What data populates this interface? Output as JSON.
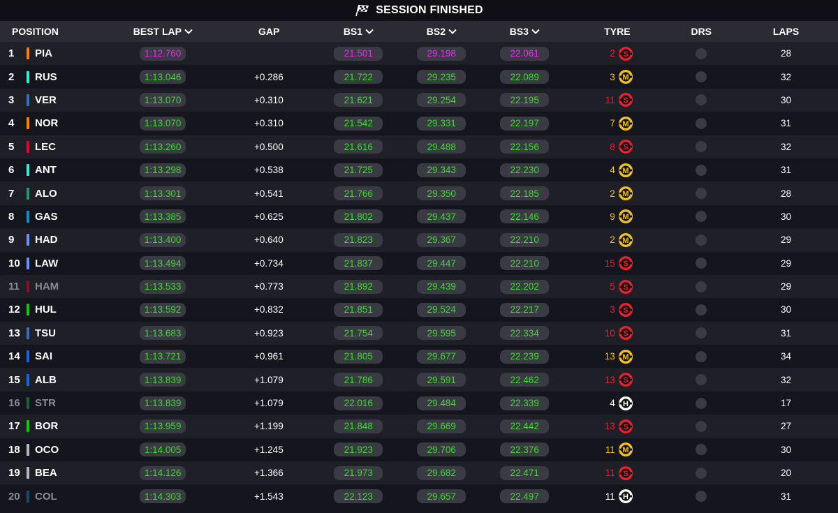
{
  "banner": {
    "title": "SESSION FINISHED",
    "icon": "chequered-flag-icon"
  },
  "columns": {
    "position": "POSITION",
    "best_lap": "BEST LAP",
    "gap": "GAP",
    "bs1": "BS1",
    "bs2": "BS2",
    "bs3": "BS3",
    "tyre": "TYRE",
    "drs": "DRS",
    "laps": "LAPS"
  },
  "colors": {
    "purple": "#e233e2",
    "green": "#3edb2c",
    "soft": "#e8212d",
    "medium": "#f5c21b",
    "hard": "#ffffff"
  },
  "rows": [
    {
      "pos": "1",
      "code": "PIA",
      "team_color": "#ff8000",
      "faded": false,
      "best_lap": "1:12.760",
      "best_color": "purple",
      "gap": "",
      "bs1": "21.501",
      "bs1_color": "purple",
      "bs2": "29.198",
      "bs2_color": "purple",
      "bs3": "22.061",
      "bs3_color": "purple",
      "tyre_age": "2",
      "tyre": "S",
      "laps": "28"
    },
    {
      "pos": "2",
      "code": "RUS",
      "team_color": "#27f4d2",
      "faded": false,
      "best_lap": "1:13.046",
      "best_color": "green",
      "gap": "+0.286",
      "bs1": "21.722",
      "bs1_color": "green",
      "bs2": "29.235",
      "bs2_color": "green",
      "bs3": "22.089",
      "bs3_color": "green",
      "tyre_age": "3",
      "tyre": "M",
      "laps": "32"
    },
    {
      "pos": "3",
      "code": "VER",
      "team_color": "#3671c6",
      "faded": false,
      "best_lap": "1:13.070",
      "best_color": "green",
      "gap": "+0.310",
      "bs1": "21.621",
      "bs1_color": "green",
      "bs2": "29.254",
      "bs2_color": "green",
      "bs3": "22.195",
      "bs3_color": "green",
      "tyre_age": "11",
      "tyre": "S",
      "laps": "30"
    },
    {
      "pos": "4",
      "code": "NOR",
      "team_color": "#ff8000",
      "faded": false,
      "best_lap": "1:13.070",
      "best_color": "green",
      "gap": "+0.310",
      "bs1": "21.542",
      "bs1_color": "green",
      "bs2": "29.331",
      "bs2_color": "green",
      "bs3": "22.197",
      "bs3_color": "green",
      "tyre_age": "7",
      "tyre": "M",
      "laps": "31"
    },
    {
      "pos": "5",
      "code": "LEC",
      "team_color": "#e8002d",
      "faded": false,
      "best_lap": "1:13.260",
      "best_color": "green",
      "gap": "+0.500",
      "bs1": "21.616",
      "bs1_color": "green",
      "bs2": "29.488",
      "bs2_color": "green",
      "bs3": "22.156",
      "bs3_color": "green",
      "tyre_age": "8",
      "tyre": "S",
      "laps": "32"
    },
    {
      "pos": "6",
      "code": "ANT",
      "team_color": "#27f4d2",
      "faded": false,
      "best_lap": "1:13.298",
      "best_color": "green",
      "gap": "+0.538",
      "bs1": "21.725",
      "bs1_color": "green",
      "bs2": "29.343",
      "bs2_color": "green",
      "bs3": "22.230",
      "bs3_color": "green",
      "tyre_age": "4",
      "tyre": "M",
      "laps": "31"
    },
    {
      "pos": "7",
      "code": "ALO",
      "team_color": "#229971",
      "faded": false,
      "best_lap": "1:13.301",
      "best_color": "green",
      "gap": "+0.541",
      "bs1": "21.766",
      "bs1_color": "green",
      "bs2": "29.350",
      "bs2_color": "green",
      "bs3": "22.185",
      "bs3_color": "green",
      "tyre_age": "2",
      "tyre": "M",
      "laps": "28"
    },
    {
      "pos": "8",
      "code": "GAS",
      "team_color": "#0093cc",
      "faded": false,
      "best_lap": "1:13.385",
      "best_color": "green",
      "gap": "+0.625",
      "bs1": "21.802",
      "bs1_color": "green",
      "bs2": "29.437",
      "bs2_color": "green",
      "bs3": "22.146",
      "bs3_color": "green",
      "tyre_age": "9",
      "tyre": "M",
      "laps": "30"
    },
    {
      "pos": "9",
      "code": "HAD",
      "team_color": "#6692ff",
      "faded": false,
      "best_lap": "1:13.400",
      "best_color": "green",
      "gap": "+0.640",
      "bs1": "21.823",
      "bs1_color": "green",
      "bs2": "29.367",
      "bs2_color": "green",
      "bs3": "22.210",
      "bs3_color": "green",
      "tyre_age": "2",
      "tyre": "M",
      "laps": "29"
    },
    {
      "pos": "10",
      "code": "LAW",
      "team_color": "#6692ff",
      "faded": false,
      "best_lap": "1:13.494",
      "best_color": "green",
      "gap": "+0.734",
      "bs1": "21.837",
      "bs1_color": "green",
      "bs2": "29.447",
      "bs2_color": "green",
      "bs3": "22.210",
      "bs3_color": "green",
      "tyre_age": "15",
      "tyre": "S",
      "laps": "29"
    },
    {
      "pos": "11",
      "code": "HAM",
      "team_color": "#8a1020",
      "faded": true,
      "best_lap": "1:13.533",
      "best_color": "green",
      "gap": "+0.773",
      "bs1": "21.892",
      "bs1_color": "green",
      "bs2": "29.439",
      "bs2_color": "green",
      "bs3": "22.202",
      "bs3_color": "green",
      "tyre_age": "5",
      "tyre": "S",
      "laps": "29"
    },
    {
      "pos": "12",
      "code": "HUL",
      "team_color": "#00d000",
      "faded": false,
      "best_lap": "1:13.592",
      "best_color": "green",
      "gap": "+0.832",
      "bs1": "21.851",
      "bs1_color": "green",
      "bs2": "29.524",
      "bs2_color": "green",
      "bs3": "22.217",
      "bs3_color": "green",
      "tyre_age": "3",
      "tyre": "S",
      "laps": "30"
    },
    {
      "pos": "13",
      "code": "TSU",
      "team_color": "#3671c6",
      "faded": false,
      "best_lap": "1:13.683",
      "best_color": "green",
      "gap": "+0.923",
      "bs1": "21.754",
      "bs1_color": "green",
      "bs2": "29.595",
      "bs2_color": "green",
      "bs3": "22.334",
      "bs3_color": "green",
      "tyre_age": "10",
      "tyre": "S",
      "laps": "31"
    },
    {
      "pos": "14",
      "code": "SAI",
      "team_color": "#1868db",
      "faded": false,
      "best_lap": "1:13.721",
      "best_color": "green",
      "gap": "+0.961",
      "bs1": "21.805",
      "bs1_color": "green",
      "bs2": "29.677",
      "bs2_color": "green",
      "bs3": "22.239",
      "bs3_color": "green",
      "tyre_age": "13",
      "tyre": "M",
      "laps": "34"
    },
    {
      "pos": "15",
      "code": "ALB",
      "team_color": "#1868db",
      "faded": false,
      "best_lap": "1:13.839",
      "best_color": "green",
      "gap": "+1.079",
      "bs1": "21.786",
      "bs1_color": "green",
      "bs2": "29.591",
      "bs2_color": "green",
      "bs3": "22.462",
      "bs3_color": "green",
      "tyre_age": "13",
      "tyre": "S",
      "laps": "32"
    },
    {
      "pos": "16",
      "code": "STR",
      "team_color": "#1f5f46",
      "faded": true,
      "best_lap": "1:13.839",
      "best_color": "green",
      "gap": "+1.079",
      "bs1": "22.016",
      "bs1_color": "green",
      "bs2": "29.484",
      "bs2_color": "green",
      "bs3": "22.339",
      "bs3_color": "green",
      "tyre_age": "4",
      "tyre": "H",
      "laps": "17"
    },
    {
      "pos": "17",
      "code": "BOR",
      "team_color": "#00d000",
      "faded": false,
      "best_lap": "1:13.959",
      "best_color": "green",
      "gap": "+1.199",
      "bs1": "21.848",
      "bs1_color": "green",
      "bs2": "29.669",
      "bs2_color": "green",
      "bs3": "22.442",
      "bs3_color": "green",
      "tyre_age": "13",
      "tyre": "S",
      "laps": "27"
    },
    {
      "pos": "18",
      "code": "OCO",
      "team_color": "#b6babd",
      "faded": false,
      "best_lap": "1:14.005",
      "best_color": "green",
      "gap": "+1.245",
      "bs1": "21.923",
      "bs1_color": "green",
      "bs2": "29.706",
      "bs2_color": "green",
      "bs3": "22.376",
      "bs3_color": "green",
      "tyre_age": "11",
      "tyre": "M",
      "laps": "30"
    },
    {
      "pos": "19",
      "code": "BEA",
      "team_color": "#b6babd",
      "faded": false,
      "best_lap": "1:14.126",
      "best_color": "green",
      "gap": "+1.366",
      "bs1": "21.973",
      "bs1_color": "green",
      "bs2": "29.682",
      "bs2_color": "green",
      "bs3": "22.471",
      "bs3_color": "green",
      "tyre_age": "11",
      "tyre": "S",
      "laps": "20"
    },
    {
      "pos": "20",
      "code": "COL",
      "team_color": "#1a4a6e",
      "faded": true,
      "best_lap": "1:14.303",
      "best_color": "green",
      "gap": "+1.543",
      "bs1": "22.123",
      "bs1_color": "green",
      "bs2": "29.657",
      "bs2_color": "green",
      "bs3": "22.497",
      "bs3_color": "green",
      "tyre_age": "11",
      "tyre": "H",
      "laps": "31"
    }
  ]
}
